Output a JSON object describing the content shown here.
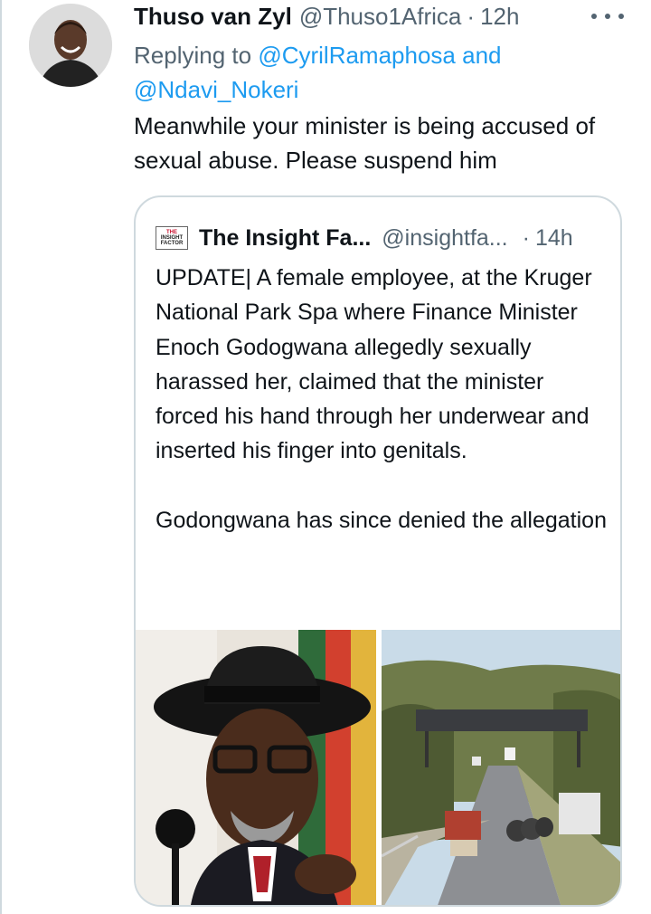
{
  "tweet": {
    "author_name": "Thuso van Zyl",
    "author_handle": "@Thuso1Africa",
    "separator": "·",
    "time": "12h",
    "replying_prefix": "Replying to",
    "mention_1": "@CyrilRamaphosa",
    "mention_joiner": "and",
    "mention_2": "@Ndavi_Nokeri",
    "text": "Meanwhile your minister is being accused of sexual abuse. Please suspend him",
    "more_icon": "more-horizontal-icon",
    "avatar_icon": "profile-avatar"
  },
  "quote": {
    "logo_line1": "THE",
    "logo_line2": "INSIGHT",
    "logo_line3": "FACTOR",
    "author_name": "The Insight Fa...",
    "author_handle": "@insightfa...",
    "separator": "·",
    "time": "14h",
    "paragraph_1": "UPDATE| A female employee, at the Kruger National Park Spa where Finance Minister Enoch Godogwana allegedly sexually harassed her, claimed that the minister forced his hand through her underwear and inserted his finger into genitals.",
    "paragraph_2": "Godongwana has since denied the allegation",
    "media_left": "photo-minister-speaking",
    "media_right": "photo-kruger-park-gate-elephants"
  },
  "colors": {
    "link": "#1d9bf0",
    "secondary_text": "#536471",
    "primary_text": "#0f1419",
    "border": "#cfd9de"
  }
}
